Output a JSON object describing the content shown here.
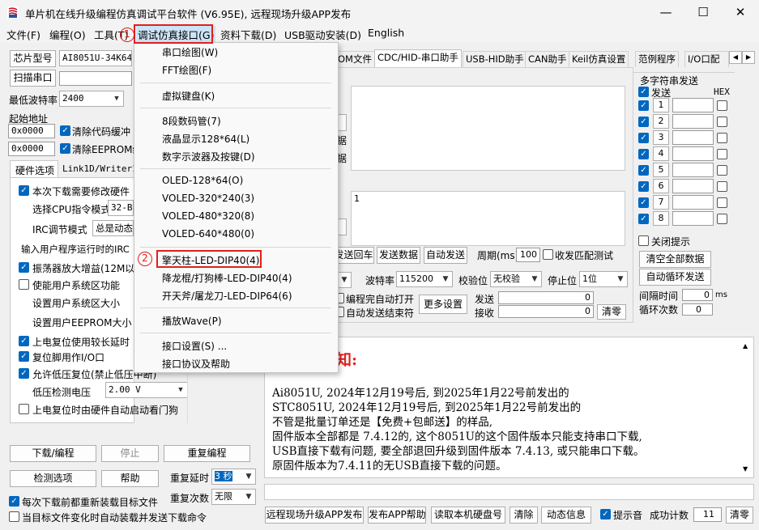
{
  "app": {
    "title": "单片机在线升级编程仿真调试平台软件 (V6.95E), 远程现场升级APP发布",
    "window_buttons": [
      "—",
      "☐",
      "✕"
    ]
  },
  "menubar": [
    "文件(F)",
    "编程(O)",
    "工具(T)",
    "调试仿真接口(G)",
    "资料下载(D)",
    "USB驱动安装(D)",
    "English"
  ],
  "left": {
    "chip_type_btn": "芯片型号",
    "chip_type_value": "AI8051U-34K64",
    "scan_port_btn": "扫描串口",
    "min_baud_label": "最低波特率",
    "min_baud_value": "2400",
    "start_addr_label": "起始地址",
    "addr1": "0x0000",
    "clear_code_label": "清除代码缓冲",
    "addr2": "0x0000",
    "clear_eeprom_label": "清除EEPROM缓",
    "tabs": [
      "硬件选项",
      "Link1D/Writer1"
    ],
    "options": {
      "reconfig": "本次下载需要修改硬件",
      "cpu_label": "选择CPU指令模式",
      "cpu_value": "32-B",
      "irc_label": "IRC调节模式",
      "irc_value": "总是动态",
      "freq_label": "输入用户程序运行时的IRC",
      "osc_gain": "振荡器放大增益(12M以",
      "user_sys": "使能用户系统区功能",
      "user_sys_size": "设置用户系统区大小",
      "user_eeprom": "设置用户EEPROM大小",
      "long_delay": "上电复位使用较长延时",
      "reset_io": "复位脚用作I/O口",
      "lvr": "允许低压复位(禁止低压中断)",
      "lvd_label": "低压检测电压",
      "lvd_value": "2.00 V",
      "wdt": "上电复位时由硬件自动启动看门狗"
    },
    "buttons": {
      "download": "下载/编程",
      "stop": "停止",
      "reprogram": "重复编程",
      "detect": "检测选项",
      "help": "帮助"
    },
    "repeat_delay_label": "重复延时",
    "repeat_delay_value": "3 秒",
    "repeat_count_label": "重复次数",
    "repeat_count_value": "无限",
    "reload_label": "每次下载前都重新装载目标文件",
    "auto_label": "当目标文件变化时自动装载并发送下载命令"
  },
  "main_tabs": [
    "OM文件",
    "CDC/HID-串口助手",
    "USB-HID助手",
    "CAN助手",
    "Keil仿真设置",
    "范例程序",
    "I/O口配"
  ],
  "assistant": {
    "recv_partial": [
      "据",
      "据"
    ],
    "send_text": "1",
    "send_loop": "发送回车",
    "send_data": "发送数据",
    "auto_send": "自动发送",
    "period_label": "周期(ms)",
    "period_value": "100",
    "match_label": "收发匹配测试",
    "baud_label": "波特率",
    "baud_value": "115200",
    "parity_label": "校验位",
    "parity_value": "无校验",
    "stop_label": "停止位",
    "stop_value": "1位",
    "auto_open": "编程完自动打开",
    "auto_end": "自动发送结束符",
    "more": "更多设置",
    "send_count_label": "发送",
    "send_count": "0",
    "recv_count_label": "接收",
    "recv_count": "0",
    "clear": "清零"
  },
  "multi": {
    "title": "多字符串发送",
    "send_hdr": "发送",
    "hex_hdr": "HEX",
    "rows": [
      "1",
      "2",
      "3",
      "4",
      "5",
      "6",
      "7",
      "8"
    ],
    "close_tip": "关闭提示",
    "clear_all": "清空全部数据",
    "auto_loop": "自动循环发送",
    "interval_label": "间隔时间",
    "interval_value": "0",
    "interval_unit": "ms",
    "loop_label": "循环次数",
    "loop_value": "0"
  },
  "notice": {
    "heading": "知:",
    "lines": [
      "Ai8051U,  2024年12月19号后, 到2025年1月22号前发出的",
      "STC8051U, 2024年12月19号后, 到2025年1月22号前发出的",
      "不管是批量订单还是【免费+包邮送】的样品,",
      "固件版本全部都是 7.4.12的, 这个8051U的这个固件版本只能支持串口下载,",
      "USB直接下载有问题, 要全部退回升级到固件版本 7.4.13, 或只能串口下载。",
      "原固件版本为7.4.11的无USB直接下载的问题。"
    ]
  },
  "bottom": {
    "remote": "远程现场升级APP发布",
    "app_help": "发布APP帮助",
    "read_disk": "读取本机硬盘号",
    "clear": "清除",
    "dynamic": "动态信息",
    "beep": "提示音",
    "success_label": "成功计数",
    "success_count": "11",
    "reset": "清零"
  },
  "dropdown": {
    "items": [
      "串口绘图(W)",
      "FFT绘图(F)",
      "虚拟键盘(K)",
      "8段数码管(7)",
      "液晶显示128*64(L)",
      "数字示波器及按键(D)",
      "OLED-128*64(O)",
      "VOLED-320*240(3)",
      "VOLED-480*320(8)",
      "VOLED-640*480(0)",
      "擎天柱-LED-DIP40(4)",
      "降龙棍/打狗棒-LED-DIP40(4)",
      "开天斧/屠龙刀-LED-DIP64(6)",
      "播放Wave(P)",
      "接口设置(S) ...",
      "接口协议及帮助"
    ],
    "markers": [
      "1",
      "2"
    ]
  },
  "colors": {
    "accent": "#0067c0",
    "highlight": "#e0201e",
    "notice_red": "#e0201e"
  }
}
